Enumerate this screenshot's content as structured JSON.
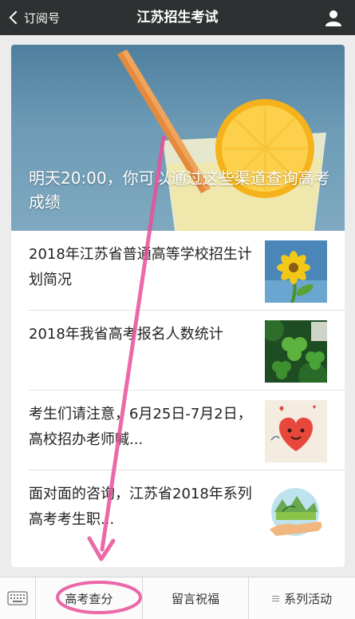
{
  "navbar": {
    "back_label": "订阅号",
    "title": "江苏招生考试",
    "user_icon": "user-icon"
  },
  "hero": {
    "title": "明天20:00，你可以通过这些渠道查询高考成绩"
  },
  "articles": [
    {
      "title": "2018年江苏省普通高等学校招生计划简况",
      "thumb": "sunflower-thumbnail"
    },
    {
      "title": "2018年我省高考报名人数统计",
      "thumb": "clover-thumbnail"
    },
    {
      "title": "考生们请注意，6月25日-7月2日，高校招办老师喊...",
      "thumb": "heart-thumbnail"
    },
    {
      "title": "面对面的咨询，江苏省2018年系列高考考生职...",
      "thumb": "plant-hand-thumbnail"
    }
  ],
  "bottom_menu": {
    "keyboard_icon": "keyboard-icon",
    "items": [
      {
        "label": "高考查分"
      },
      {
        "label": "留言祝福"
      },
      {
        "label": "系列活动",
        "icon": "list-icon"
      }
    ]
  },
  "annotation": {
    "color": "#e84f9a"
  }
}
